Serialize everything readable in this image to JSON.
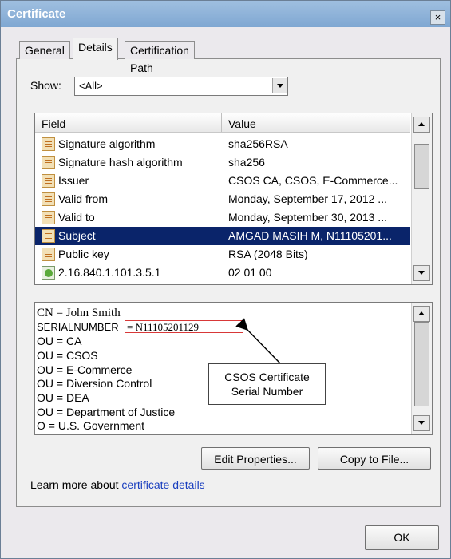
{
  "window": {
    "title": "Certificate",
    "close_glyph": "×"
  },
  "tabs": [
    {
      "label": "General"
    },
    {
      "label": "Details"
    },
    {
      "label": "Certification Path"
    }
  ],
  "show": {
    "label": "Show:",
    "value": "<All>"
  },
  "field_list": {
    "headers": {
      "field": "Field",
      "value": "Value"
    },
    "rows": [
      {
        "field": "Signature algorithm",
        "value": "sha256RSA",
        "icon": "certificate-field-icon"
      },
      {
        "field": "Signature hash algorithm",
        "value": "sha256",
        "icon": "certificate-field-icon"
      },
      {
        "field": "Issuer",
        "value": "CSOS CA, CSOS, E-Commerce...",
        "icon": "certificate-field-icon"
      },
      {
        "field": "Valid from",
        "value": "Monday, September 17, 2012 ...",
        "icon": "certificate-field-icon"
      },
      {
        "field": "Valid to",
        "value": "Monday, September 30, 2013 ...",
        "icon": "certificate-field-icon"
      },
      {
        "field": "Subject",
        "value": "AMGAD MASIH M, N11105201...",
        "icon": "certificate-field-icon",
        "selected": true
      },
      {
        "field": "Public key",
        "value": "RSA (2048 Bits)",
        "icon": "certificate-field-icon"
      },
      {
        "field": "2.16.840.1.101.3.5.1",
        "value": "02 01 00",
        "icon": "extension-icon"
      }
    ]
  },
  "detail": {
    "cn": "CN = John Smith",
    "serial_label": "SERIALNUMBER",
    "serial_value": "= N11105201129",
    "lines": [
      "OU = CA",
      "OU = CSOS",
      "OU = E-Commerce",
      "OU = Diversion Control",
      "OU = DEA",
      "OU = Department of Justice",
      "O = U.S. Government"
    ]
  },
  "callout": {
    "line1": "CSOS Certificate",
    "line2": "Serial Number"
  },
  "buttons": {
    "edit_properties": "Edit Properties...",
    "copy_to_file": "Copy to File...",
    "ok": "OK"
  },
  "learn_more": {
    "prefix": "Learn more about ",
    "link": "certificate details"
  },
  "colors": {
    "selection": "#0a246a",
    "callout_box": "#d83838",
    "link": "#1a3fbf"
  }
}
